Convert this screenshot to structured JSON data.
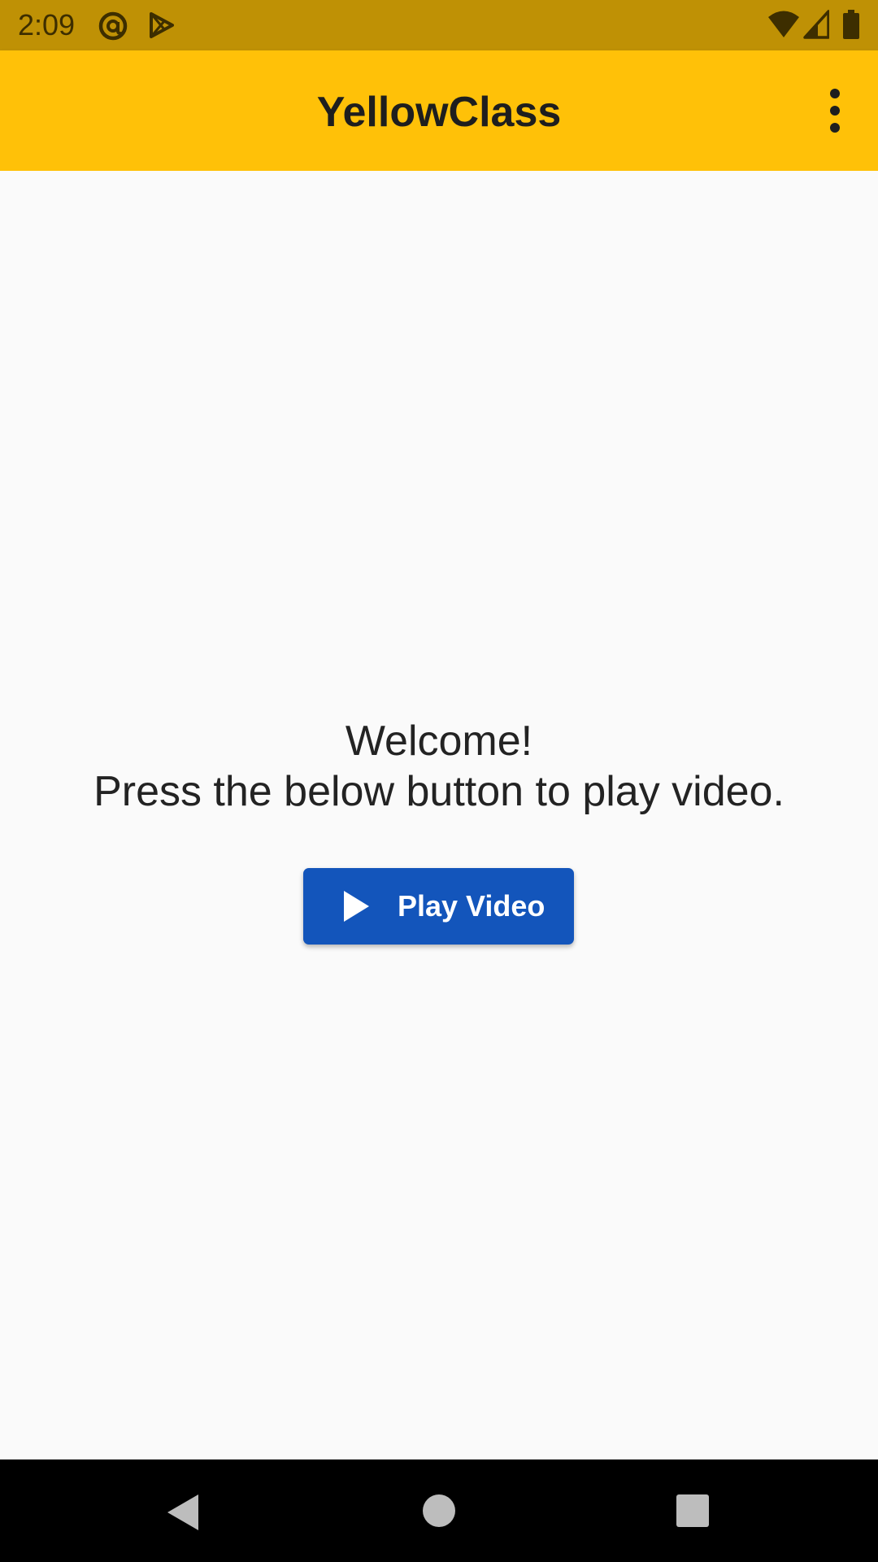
{
  "status_bar": {
    "time": "2:09",
    "left_icons": [
      "at-sign-icon",
      "play-store-icon"
    ],
    "right_icons": [
      "wifi-icon",
      "cellular-signal-icon",
      "battery-icon"
    ],
    "color": "#bf9105"
  },
  "app_bar": {
    "title": "YellowClass",
    "menu_icon": "more-vert-icon",
    "color": "#ffc108"
  },
  "main": {
    "welcome_line": "Welcome!",
    "instruction_line": "Press the below button to play video.",
    "play_button": {
      "icon": "play-icon",
      "label": "Play Video",
      "color": "#1355bb"
    }
  },
  "nav_bar": {
    "buttons": [
      "back-icon",
      "home-icon",
      "recents-icon"
    ]
  }
}
